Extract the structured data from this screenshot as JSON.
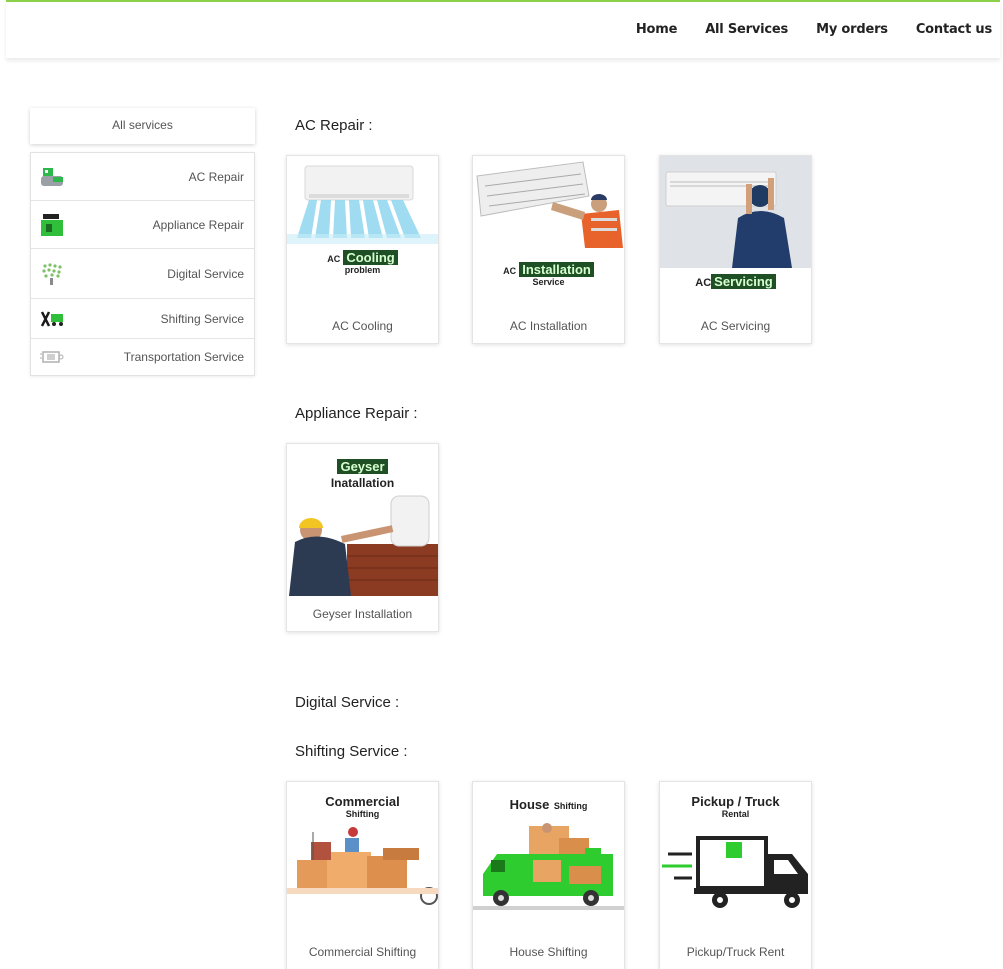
{
  "nav": {
    "home": "Home",
    "all_services": "All Services",
    "my_orders": "My orders",
    "contact": "Contact us"
  },
  "sidebar": {
    "header": "All services",
    "items": [
      {
        "label": "AC Repair",
        "icon": "ac-repair-icon"
      },
      {
        "label": "Appliance Repair",
        "icon": "appliance-repair-icon"
      },
      {
        "label": "Digital Service",
        "icon": "digital-service-icon"
      },
      {
        "label": "Shifting Service",
        "icon": "shifting-service-icon"
      },
      {
        "label": "Transportation Service",
        "icon": "transportation-service-icon"
      }
    ]
  },
  "sections": {
    "ac_repair": "AC Repair :",
    "appliance_repair": "Appliance Repair :",
    "digital_service": "Digital Service :",
    "shifting_service": "Shifting Service :"
  },
  "cards": {
    "ac_cooling": {
      "label": "AC Cooling",
      "img_prefix": "AC",
      "img_tag": "Cooling",
      "img_sub": "problem"
    },
    "ac_installation": {
      "label": "AC Installation",
      "img_prefix": "AC",
      "img_tag": "Installation",
      "img_sub": "Service"
    },
    "ac_servicing": {
      "label": "AC Servicing",
      "img_prefix": "AC",
      "img_tag": "Servicing"
    },
    "geyser": {
      "label": "Geyser Installation",
      "img_tag": "Geyser",
      "img_sub": "Inatallation"
    },
    "commercial": {
      "label": "Commercial Shifting",
      "img_title": "Commercial",
      "img_sub": "Shifting"
    },
    "house": {
      "label": "House Shifting",
      "img_title": "House",
      "img_sub": "Shifting"
    },
    "pickup": {
      "label": "Pickup/Truck Rent",
      "img_title": "Pickup / Truck",
      "img_sub": "Rental"
    }
  },
  "colors": {
    "accent": "#8bd14a",
    "tag_bg": "#1f4f25",
    "truck_green": "#2ecc2e"
  }
}
